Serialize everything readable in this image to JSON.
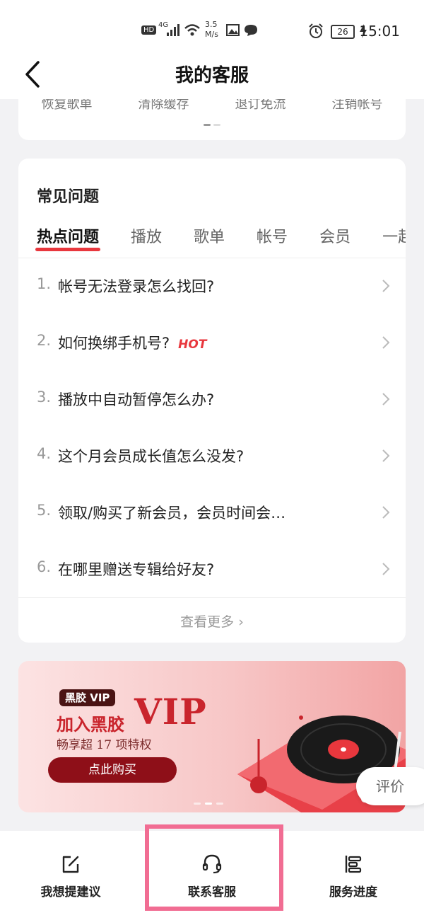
{
  "status_bar": {
    "network_labels": [
      "HD",
      "4G"
    ],
    "speed": "3.5\nM/s",
    "battery": "26",
    "time": "15:01"
  },
  "header": {
    "title": "我的客服",
    "back_icon": "back-arrow-icon"
  },
  "quick_actions": [
    "恢复歌单",
    "清除缓存",
    "退订免流",
    "注销帐号"
  ],
  "faq": {
    "title": "常见问题",
    "tabs": [
      "热点问题",
      "播放",
      "歌单",
      "帐号",
      "会员",
      "一起"
    ],
    "active_tab": "热点问题",
    "questions": [
      {
        "num": "1.",
        "text": "帐号无法登录怎么找回?",
        "badge": ""
      },
      {
        "num": "2.",
        "text": "如何换绑手机号?",
        "badge": "HOT"
      },
      {
        "num": "3.",
        "text": "播放中自动暂停怎么办?",
        "badge": ""
      },
      {
        "num": "4.",
        "text": "这个月会员成长值怎么没发?",
        "badge": ""
      },
      {
        "num": "5.",
        "text": "领取/购买了新会员，会员时间会…",
        "badge": ""
      },
      {
        "num": "6.",
        "text": "在哪里赠送专辑给好友?",
        "badge": ""
      }
    ],
    "more": "查看更多 ›"
  },
  "banner": {
    "badge": "黑胶 VIP",
    "headline": "加入黑胶",
    "headline_big": "VIP",
    "sub": "畅享超 17 项特权",
    "button": "点此购买",
    "colors": {
      "accent": "#c9242c",
      "button": "#8e0f18"
    }
  },
  "rate_button": "评价",
  "bottom_nav": [
    {
      "label": "我想提建议",
      "icon": "edit-icon"
    },
    {
      "label": "联系客服",
      "icon": "headset-icon"
    },
    {
      "label": "服务进度",
      "icon": "progress-list-icon"
    }
  ],
  "colors": {
    "brand_red": "#e8373d",
    "highlight": "#f16d93"
  }
}
